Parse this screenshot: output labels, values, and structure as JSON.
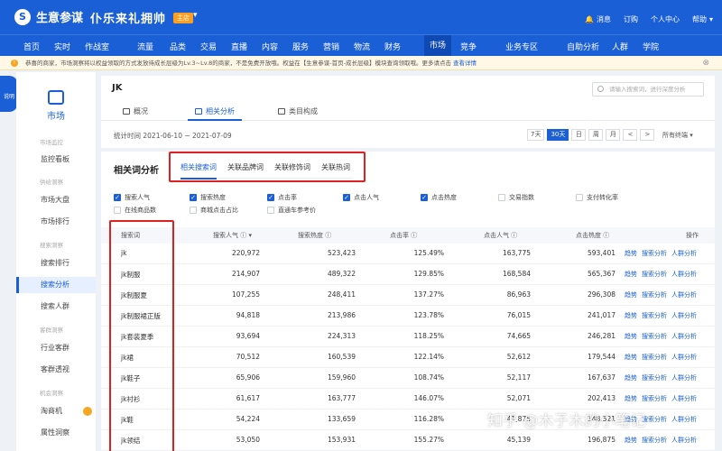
{
  "header": {
    "brand": "生意参谋",
    "shop_name": "仆乐来礼拥帅",
    "shop_badge": "主店",
    "links": [
      "消息",
      "订购",
      "个人中心",
      "帮助"
    ]
  },
  "nav": {
    "items": [
      "首页",
      "实时",
      "作战室",
      "流量",
      "品类",
      "交易",
      "直播",
      "内容",
      "服务",
      "营销",
      "物流",
      "财务",
      "市场",
      "竞争",
      "业务专区",
      "自助分析",
      "人群",
      "学院"
    ],
    "active": "市场"
  },
  "notice": {
    "text": "恭喜的商家，市场洞察将以权益领取的方式发放待成长层级为Lv.3~Lv.8的商家，不是免费开放哦。权益在【生意参谋-首页-成长层级】模块查询领取哦。更多请点击",
    "link": "查看详情"
  },
  "sidebar": {
    "badge": "说明",
    "title": "市场",
    "groups": [
      {
        "label": "市场监控",
        "items": [
          "监控看板"
        ]
      },
      {
        "label": "供给洞察",
        "items": [
          "市场大盘",
          "市场排行"
        ]
      },
      {
        "label": "搜索洞察",
        "items": [
          "搜索排行",
          "搜索分析",
          "搜索人群"
        ]
      },
      {
        "label": "客群洞察",
        "items": [
          "行业客群",
          "客群透视"
        ]
      },
      {
        "label": "机会洞察",
        "items": [
          "淘商机",
          "属性洞察"
        ]
      }
    ],
    "active_item": "搜索分析"
  },
  "main": {
    "keyword": "JK",
    "search_placeholder": "请输入搜索词，进行深度分析",
    "tabs": [
      "概况",
      "相关分析",
      "类目构成"
    ],
    "active_tab": "相关分析",
    "stat_time": "统计时间 2021-06-10 ~ 2021-07-09",
    "date_buttons": [
      "7天",
      "30天",
      "日",
      "周",
      "月",
      "<",
      ">"
    ],
    "active_date": "30天",
    "terminal": "所有终端",
    "section_title": "相关词分析",
    "sub_tabs": [
      "相关搜索词",
      "关联品牌词",
      "关联修饰词",
      "关联热词"
    ],
    "active_sub_tab": "相关搜索词",
    "filters": [
      {
        "label": "搜索人气",
        "checked": true
      },
      {
        "label": "搜索热度",
        "checked": true
      },
      {
        "label": "点击率",
        "checked": true
      },
      {
        "label": "点击人气",
        "checked": true
      },
      {
        "label": "点击热度",
        "checked": true
      },
      {
        "label": "交易指数",
        "checked": false
      },
      {
        "label": "支付转化率",
        "checked": false
      },
      {
        "label": "在线商品数",
        "checked": false
      },
      {
        "label": "商城点击占比",
        "checked": false
      },
      {
        "label": "直通车参考价",
        "checked": false
      }
    ],
    "table": {
      "headers": [
        "搜索词",
        "搜索人气",
        "搜索热度",
        "点击率",
        "点击人气",
        "点击热度",
        "操作"
      ],
      "ops": [
        "趋势",
        "搜索分析",
        "人群分析"
      ],
      "rows": [
        [
          "jk",
          "220,972",
          "523,423",
          "125.49%",
          "163,775",
          "593,401"
        ],
        [
          "jk制服",
          "214,907",
          "489,322",
          "129.85%",
          "168,584",
          "565,367"
        ],
        [
          "jk制服夏",
          "107,255",
          "248,411",
          "137.27%",
          "86,963",
          "296,308"
        ],
        [
          "jk制服裙正版",
          "94,818",
          "213,986",
          "123.78%",
          "76,015",
          "241,017"
        ],
        [
          "jk套装夏季",
          "93,694",
          "224,313",
          "118.25%",
          "74,665",
          "246,281"
        ],
        [
          "jk裙",
          "70,512",
          "160,539",
          "122.14%",
          "52,612",
          "179,544"
        ],
        [
          "jk鞋子",
          "65,906",
          "159,960",
          "108.74%",
          "52,117",
          "167,637"
        ],
        [
          "jk衬衫",
          "61,617",
          "163,777",
          "146.07%",
          "52,071",
          "202,413"
        ],
        [
          "jk鞋",
          "54,224",
          "133,659",
          "116.28%",
          "41,875",
          "148,521"
        ],
        [
          "jk领结",
          "53,050",
          "153,931",
          "155.27%",
          "45,139",
          "196,875"
        ]
      ]
    }
  },
  "watermark": "知乎 @木子木的小笔记",
  "colors": {
    "brand": "#1a5fd6",
    "highlight_box": "#e02020",
    "warning": "#f5a623"
  }
}
